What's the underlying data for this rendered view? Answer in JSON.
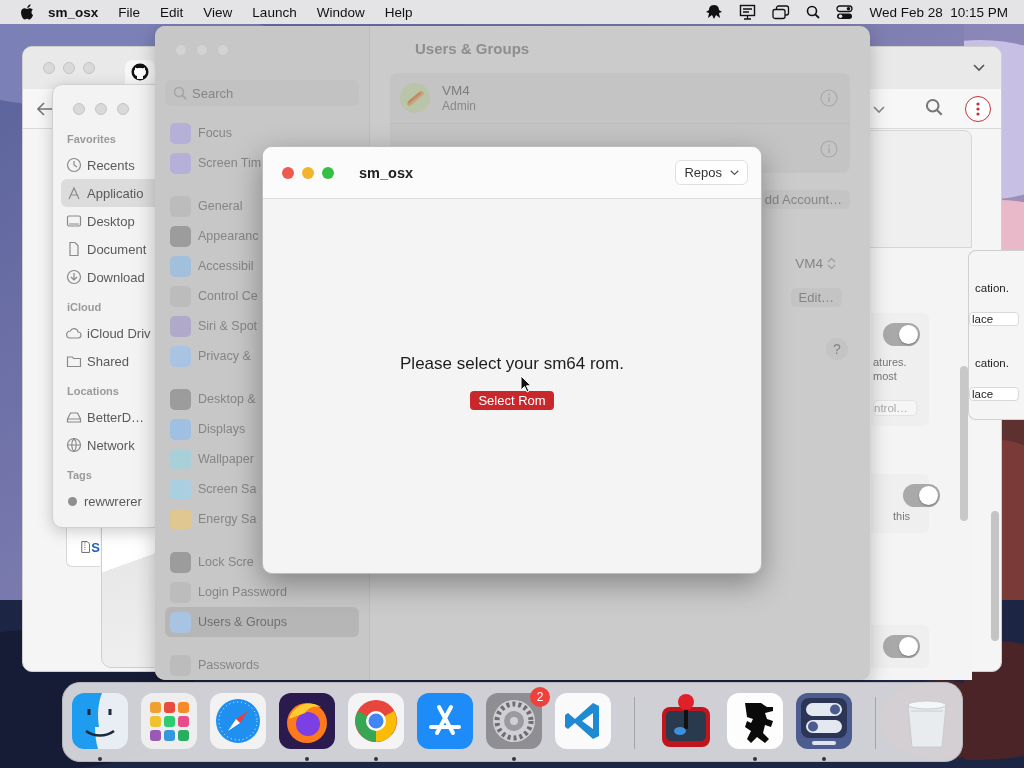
{
  "menu_bar": {
    "app_name": "sm_osx",
    "menus": [
      "File",
      "Edit",
      "View",
      "Launch",
      "Window",
      "Help"
    ],
    "clock": "Wed Feb 28  10:15 PM"
  },
  "browser": {
    "file_label": "S"
  },
  "finder": {
    "sections": [
      {
        "title": "Favorites",
        "items": [
          {
            "label": "Recents",
            "kind": "clock",
            "selected": false
          },
          {
            "label": "Applicatio",
            "kind": "apps",
            "selected": true
          },
          {
            "label": "Desktop",
            "kind": "desktop",
            "selected": false
          },
          {
            "label": "Document",
            "kind": "doc",
            "selected": false
          },
          {
            "label": "Download",
            "kind": "download",
            "selected": false
          }
        ]
      },
      {
        "title": "iCloud",
        "items": [
          {
            "label": "iCloud Driv",
            "kind": "cloud",
            "selected": false
          },
          {
            "label": "Shared",
            "kind": "folder",
            "selected": false
          }
        ]
      },
      {
        "title": "Locations",
        "items": [
          {
            "label": "BetterD…",
            "kind": "drive",
            "selected": false
          },
          {
            "label": "Network",
            "kind": "globe",
            "selected": false
          }
        ]
      },
      {
        "title": "Tags",
        "items": [
          {
            "label": "rewwrerer",
            "kind": "tag",
            "selected": false
          }
        ]
      }
    ]
  },
  "settings": {
    "title": "Users & Groups",
    "search_placeholder": "Search",
    "sidebar_groups": [
      {
        "items": [
          {
            "label": "Focus",
            "color": "#b4b0d8",
            "selected": false
          },
          {
            "label": "Screen Tim",
            "color": "#b4b0d8",
            "selected": false
          }
        ]
      },
      {
        "items": [
          {
            "label": "General",
            "color": "#bcbcbc",
            "selected": false
          },
          {
            "label": "Appearanc",
            "color": "#9c9c9c",
            "selected": false
          },
          {
            "label": "Accessibil",
            "color": "#a2bfdc",
            "selected": false
          },
          {
            "label": "Control Ce",
            "color": "#bcbcbc",
            "selected": false
          },
          {
            "label": "Siri & Spot",
            "color": "#b1a9c9",
            "selected": false
          },
          {
            "label": "Privacy & ",
            "color": "#a9c3e3",
            "selected": false
          }
        ]
      },
      {
        "items": [
          {
            "label": "Desktop & ",
            "color": "#9c9c9c",
            "selected": false
          },
          {
            "label": "Displays",
            "color": "#9fc0e3",
            "selected": false
          },
          {
            "label": "Wallpaper",
            "color": "#a9cfd9",
            "selected": false
          },
          {
            "label": "Screen Sa",
            "color": "#a9cfe0",
            "selected": false
          },
          {
            "label": "Energy Sa",
            "color": "#e0c690",
            "selected": false
          }
        ]
      },
      {
        "items": [
          {
            "label": "Lock Scre",
            "color": "#9c9c9c",
            "selected": false
          },
          {
            "label": "Login Password",
            "color": "#bcbcbc",
            "selected": false
          },
          {
            "label": "Users & Groups",
            "color": "#a9c3e3",
            "selected": true
          }
        ]
      },
      {
        "items": [
          {
            "label": "Passwords",
            "color": "#bcbcbc",
            "selected": false
          }
        ]
      }
    ],
    "users": [
      {
        "name": "VM4",
        "role": "Admin"
      }
    ],
    "add_account_button": "dd Account…",
    "login_user": "VM4",
    "edit_button": "Edit…",
    "help_button": "?"
  },
  "right_panel": {
    "toggles": [
      {
        "on": true
      },
      {
        "on": true
      },
      {
        "on": true
      }
    ],
    "note_lines": [
      "atures.",
      "most"
    ],
    "control_button": "ntrol…",
    "note_2": "this"
  },
  "far_right": {
    "rows": [
      {
        "text": "cation.",
        "field": "lace"
      },
      {
        "text": "cation.",
        "field": "lace"
      }
    ]
  },
  "dialog": {
    "title": "sm_osx",
    "repos_menu": "Repos",
    "message": "Please select your sm64 rom.",
    "button": "Select Rom"
  },
  "dock": {
    "apps": [
      {
        "kind": "finder",
        "running": true
      },
      {
        "kind": "launchpad",
        "running": false
      },
      {
        "kind": "safari",
        "running": false
      },
      {
        "kind": "firefox",
        "running": true
      },
      {
        "kind": "chrome",
        "running": true
      },
      {
        "kind": "appstore",
        "running": false
      },
      {
        "kind": "settings",
        "running": true,
        "badge": "2"
      },
      {
        "kind": "vscode",
        "running": false
      },
      {
        "kind": "separator"
      },
      {
        "kind": "joystick",
        "running": false
      },
      {
        "kind": "mario",
        "running": true
      },
      {
        "kind": "toggles",
        "running": true
      },
      {
        "kind": "separator"
      },
      {
        "kind": "trash",
        "running": false
      }
    ]
  }
}
